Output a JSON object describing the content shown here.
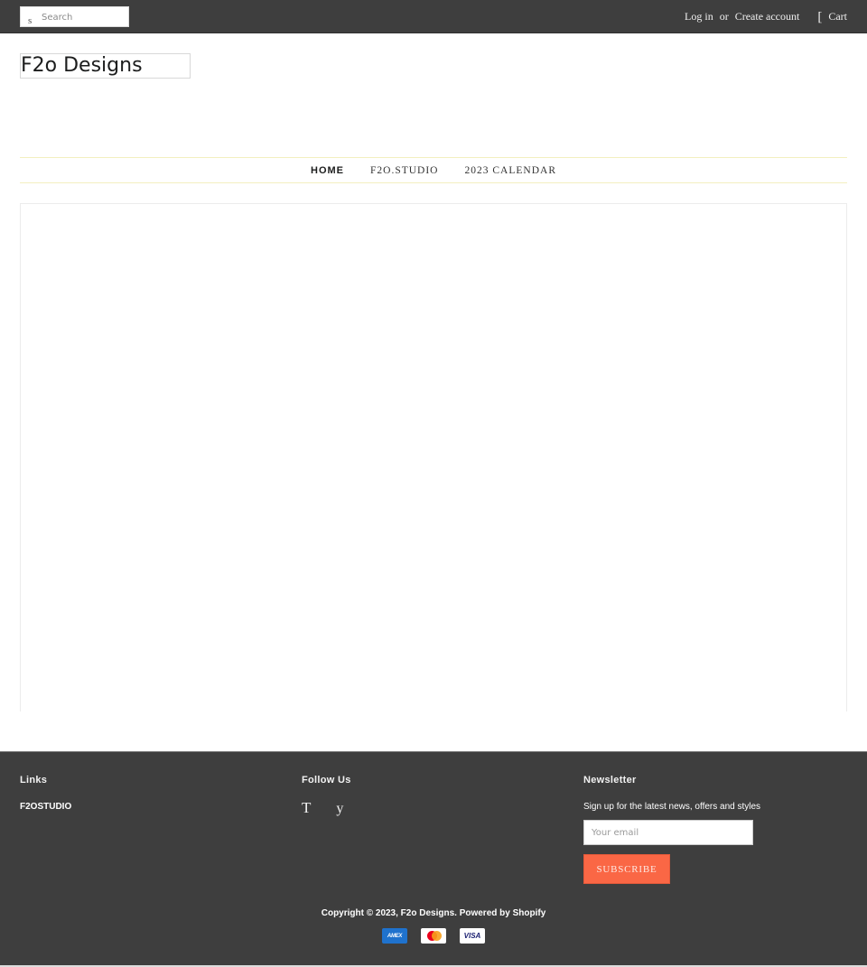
{
  "topbar": {
    "search": {
      "icon": "search-icon",
      "icon_glyph": "s",
      "placeholder": "Search",
      "value": ""
    },
    "login_label": "Log in",
    "or_label": "or",
    "create_account_label": "Create account",
    "cart_icon": "cart-icon",
    "cart_icon_glyph": "[",
    "cart_label": "Cart"
  },
  "header": {
    "logo_text": "F2o Designs"
  },
  "nav": {
    "items": [
      {
        "label": "HOME",
        "active": true
      },
      {
        "label": "F2O.STUDIO",
        "active": false
      },
      {
        "label": "2023 CALENDAR",
        "active": false
      }
    ]
  },
  "footer": {
    "links": {
      "title": "Links",
      "items": [
        {
          "label": "F2OSTUDIO"
        }
      ]
    },
    "follow": {
      "title": "Follow Us",
      "icons": [
        {
          "name": "tumblr-icon",
          "glyph": "T"
        },
        {
          "name": "twitter-icon",
          "glyph": "y"
        }
      ]
    },
    "newsletter": {
      "title": "Newsletter",
      "text": "Sign up for the latest news, offers and styles",
      "email_placeholder": "Your email",
      "email_value": "",
      "subscribe_label": "SUBSCRIBE",
      "subscribe_color": "#fa6745"
    },
    "copyright": "Copyright © 2023, F2o Designs. Powered by Shopify",
    "payments": [
      {
        "name": "amex",
        "label": "AMEX"
      },
      {
        "name": "mastercard",
        "label": ""
      },
      {
        "name": "visa",
        "label": "VISA"
      }
    ]
  }
}
